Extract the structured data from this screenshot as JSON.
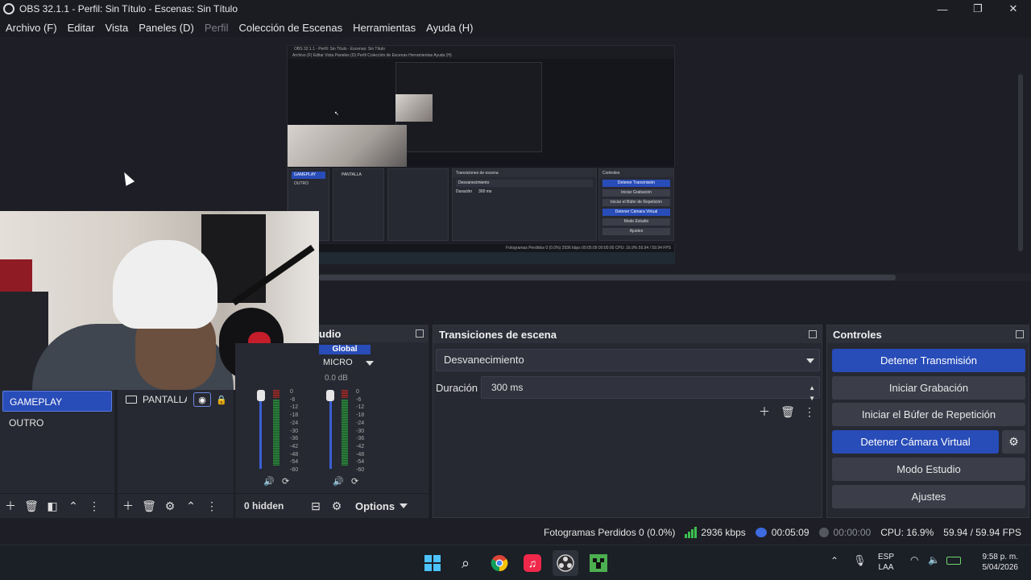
{
  "window": {
    "title": "OBS 32.1.1 - Perfil: Sin Título - Escenas: Sin Título",
    "minimize": "—",
    "maximize": "❐",
    "close": "✕"
  },
  "menu": {
    "items": [
      "Archivo (F)",
      "Editar",
      "Vista",
      "Paneles (D)",
      "Perfil",
      "Colección de Escenas",
      "Herramientas",
      "Ayuda (H)"
    ]
  },
  "nested_preview": {
    "title": "OBS 32.1.1 - Perfil: Sin Título - Escenas: Sin Título",
    "menu": "Archivo (F)   Editar   Vista   Paneles (D)   Perfil   Colección de Escenas   Herramientas   Ayuda (H)",
    "transitions_title": "Transiciones de escena",
    "transition": "Desvanecimiento",
    "duration_label": "Duración",
    "duration": "300 ms",
    "controls_title": "Controles",
    "controls": [
      "Detener Transmisión",
      "Iniciar Grabación",
      "Iniciar el Búfer de Repetición",
      "Detener Cámara Virtual",
      "Modo Estudio",
      "Ajustes"
    ],
    "scenes": [
      "GAMEPLAY",
      "OUTRO"
    ],
    "source": "PANTALLA",
    "status": "Fotogramas Perdidos 0 (0.0%)   2936 kbps   00:05:09   00:00:00   CPU: 16.9%   59.94 / 59.94 FPS"
  },
  "scenes": {
    "items": [
      {
        "label": "GAMEPLAY",
        "active": true
      },
      {
        "label": "OUTRO",
        "active": false
      }
    ]
  },
  "sources": {
    "items": [
      {
        "label": "PANTALLA"
      }
    ]
  },
  "mixer": {
    "title": "udio",
    "global": "Global",
    "channel": "MICRO",
    "db": "0.0 dB",
    "scale": [
      "0",
      "-6",
      "-12",
      "-18",
      "-24",
      "-30",
      "-36",
      "-42",
      "-48",
      "-54",
      "-60"
    ],
    "hidden": "0 hidden",
    "options": "Options"
  },
  "transitions": {
    "title": "Transiciones de escena",
    "selected": "Desvanecimiento",
    "duration_label": "Duración",
    "duration": "300 ms"
  },
  "controls": {
    "title": "Controles",
    "stop_stream": "Detener Transmisión",
    "start_record": "Iniciar Grabación",
    "replay_buffer": "Iniciar el Búfer de Repetición",
    "stop_virtualcam": "Detener Cámara Virtual",
    "studio_mode": "Modo Estudio",
    "settings": "Ajustes"
  },
  "status": {
    "dropped": "Fotogramas Perdidos 0 (0.0%)",
    "bitrate": "2936 kbps",
    "stream_time": "00:05:09",
    "record_time": "00:00:00",
    "cpu": "CPU: 16.9%",
    "fps": "59.94 / 59.94 FPS"
  },
  "tray": {
    "lang1": "ESP",
    "lang2": "LAA",
    "time": "9:58 p. m.",
    "date": "5/04/2026"
  },
  "colors": {
    "accent": "#284cb8",
    "panel": "#272932",
    "background": "#1e1f26"
  }
}
